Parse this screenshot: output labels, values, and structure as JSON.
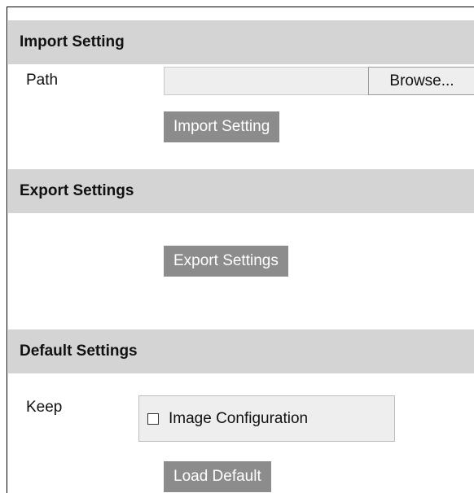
{
  "import_section": {
    "title": "Import Setting",
    "path_label": "Path",
    "path_value": "",
    "browse_label": "Browse...",
    "import_button_label": "Import Setting"
  },
  "export_section": {
    "title": "Export Settings",
    "export_button_label": "Export Settings"
  },
  "default_section": {
    "title": "Default Settings",
    "keep_label": "Keep",
    "image_configuration_label": "Image Configuration",
    "image_configuration_checked": false,
    "load_default_label": "Load Default"
  }
}
